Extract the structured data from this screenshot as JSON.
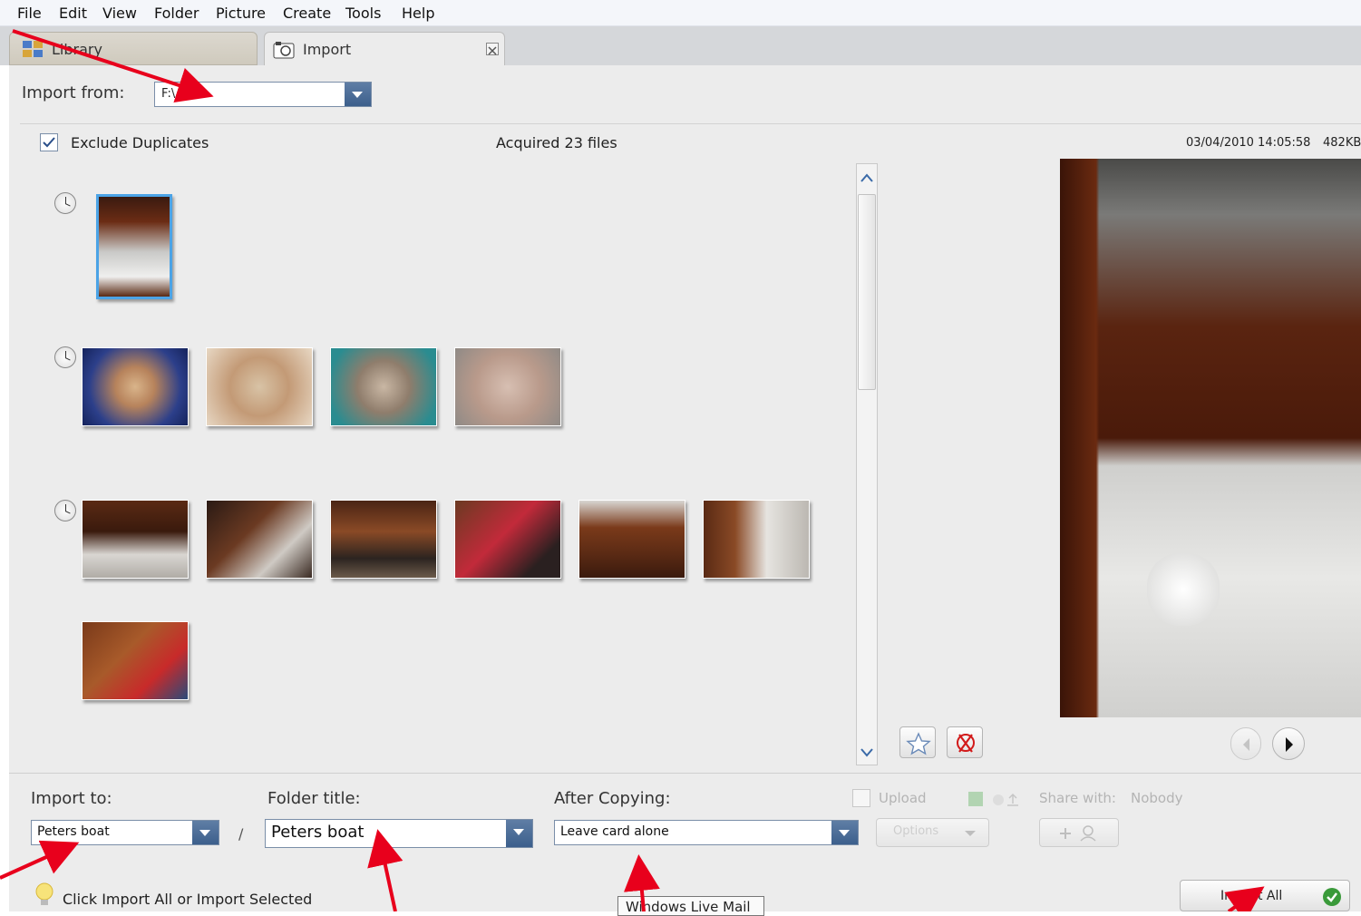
{
  "menu": [
    "File",
    "Edit",
    "View",
    "Folder",
    "Picture",
    "Create",
    "Tools",
    "Help"
  ],
  "tabs": {
    "library": "Library",
    "import": "Import"
  },
  "import_from": {
    "label": "Import from:",
    "value": "F:\\"
  },
  "toolbar": {
    "exclude_duplicates_label": "Exclude Duplicates",
    "exclude_duplicates_checked": true,
    "acquired_text": "Acquired 23 files"
  },
  "preview": {
    "date": "03/04/2010 14:05:58",
    "size": "482KB"
  },
  "import_to": {
    "label": "Import to:",
    "value": "Peters boat",
    "separator": "/"
  },
  "folder_title": {
    "label": "Folder title:",
    "value": "Peters boat"
  },
  "after_copying": {
    "label": "After Copying:",
    "value": "Leave card alone"
  },
  "upload": {
    "label": "Upload",
    "share_with_label": "Share with:",
    "share_with_value": "Nobody",
    "options_label": "Options"
  },
  "footer": {
    "hint": "Click Import All or Import Selected",
    "tooltip": "Windows Live Mail",
    "import_all_label": "Import All"
  }
}
